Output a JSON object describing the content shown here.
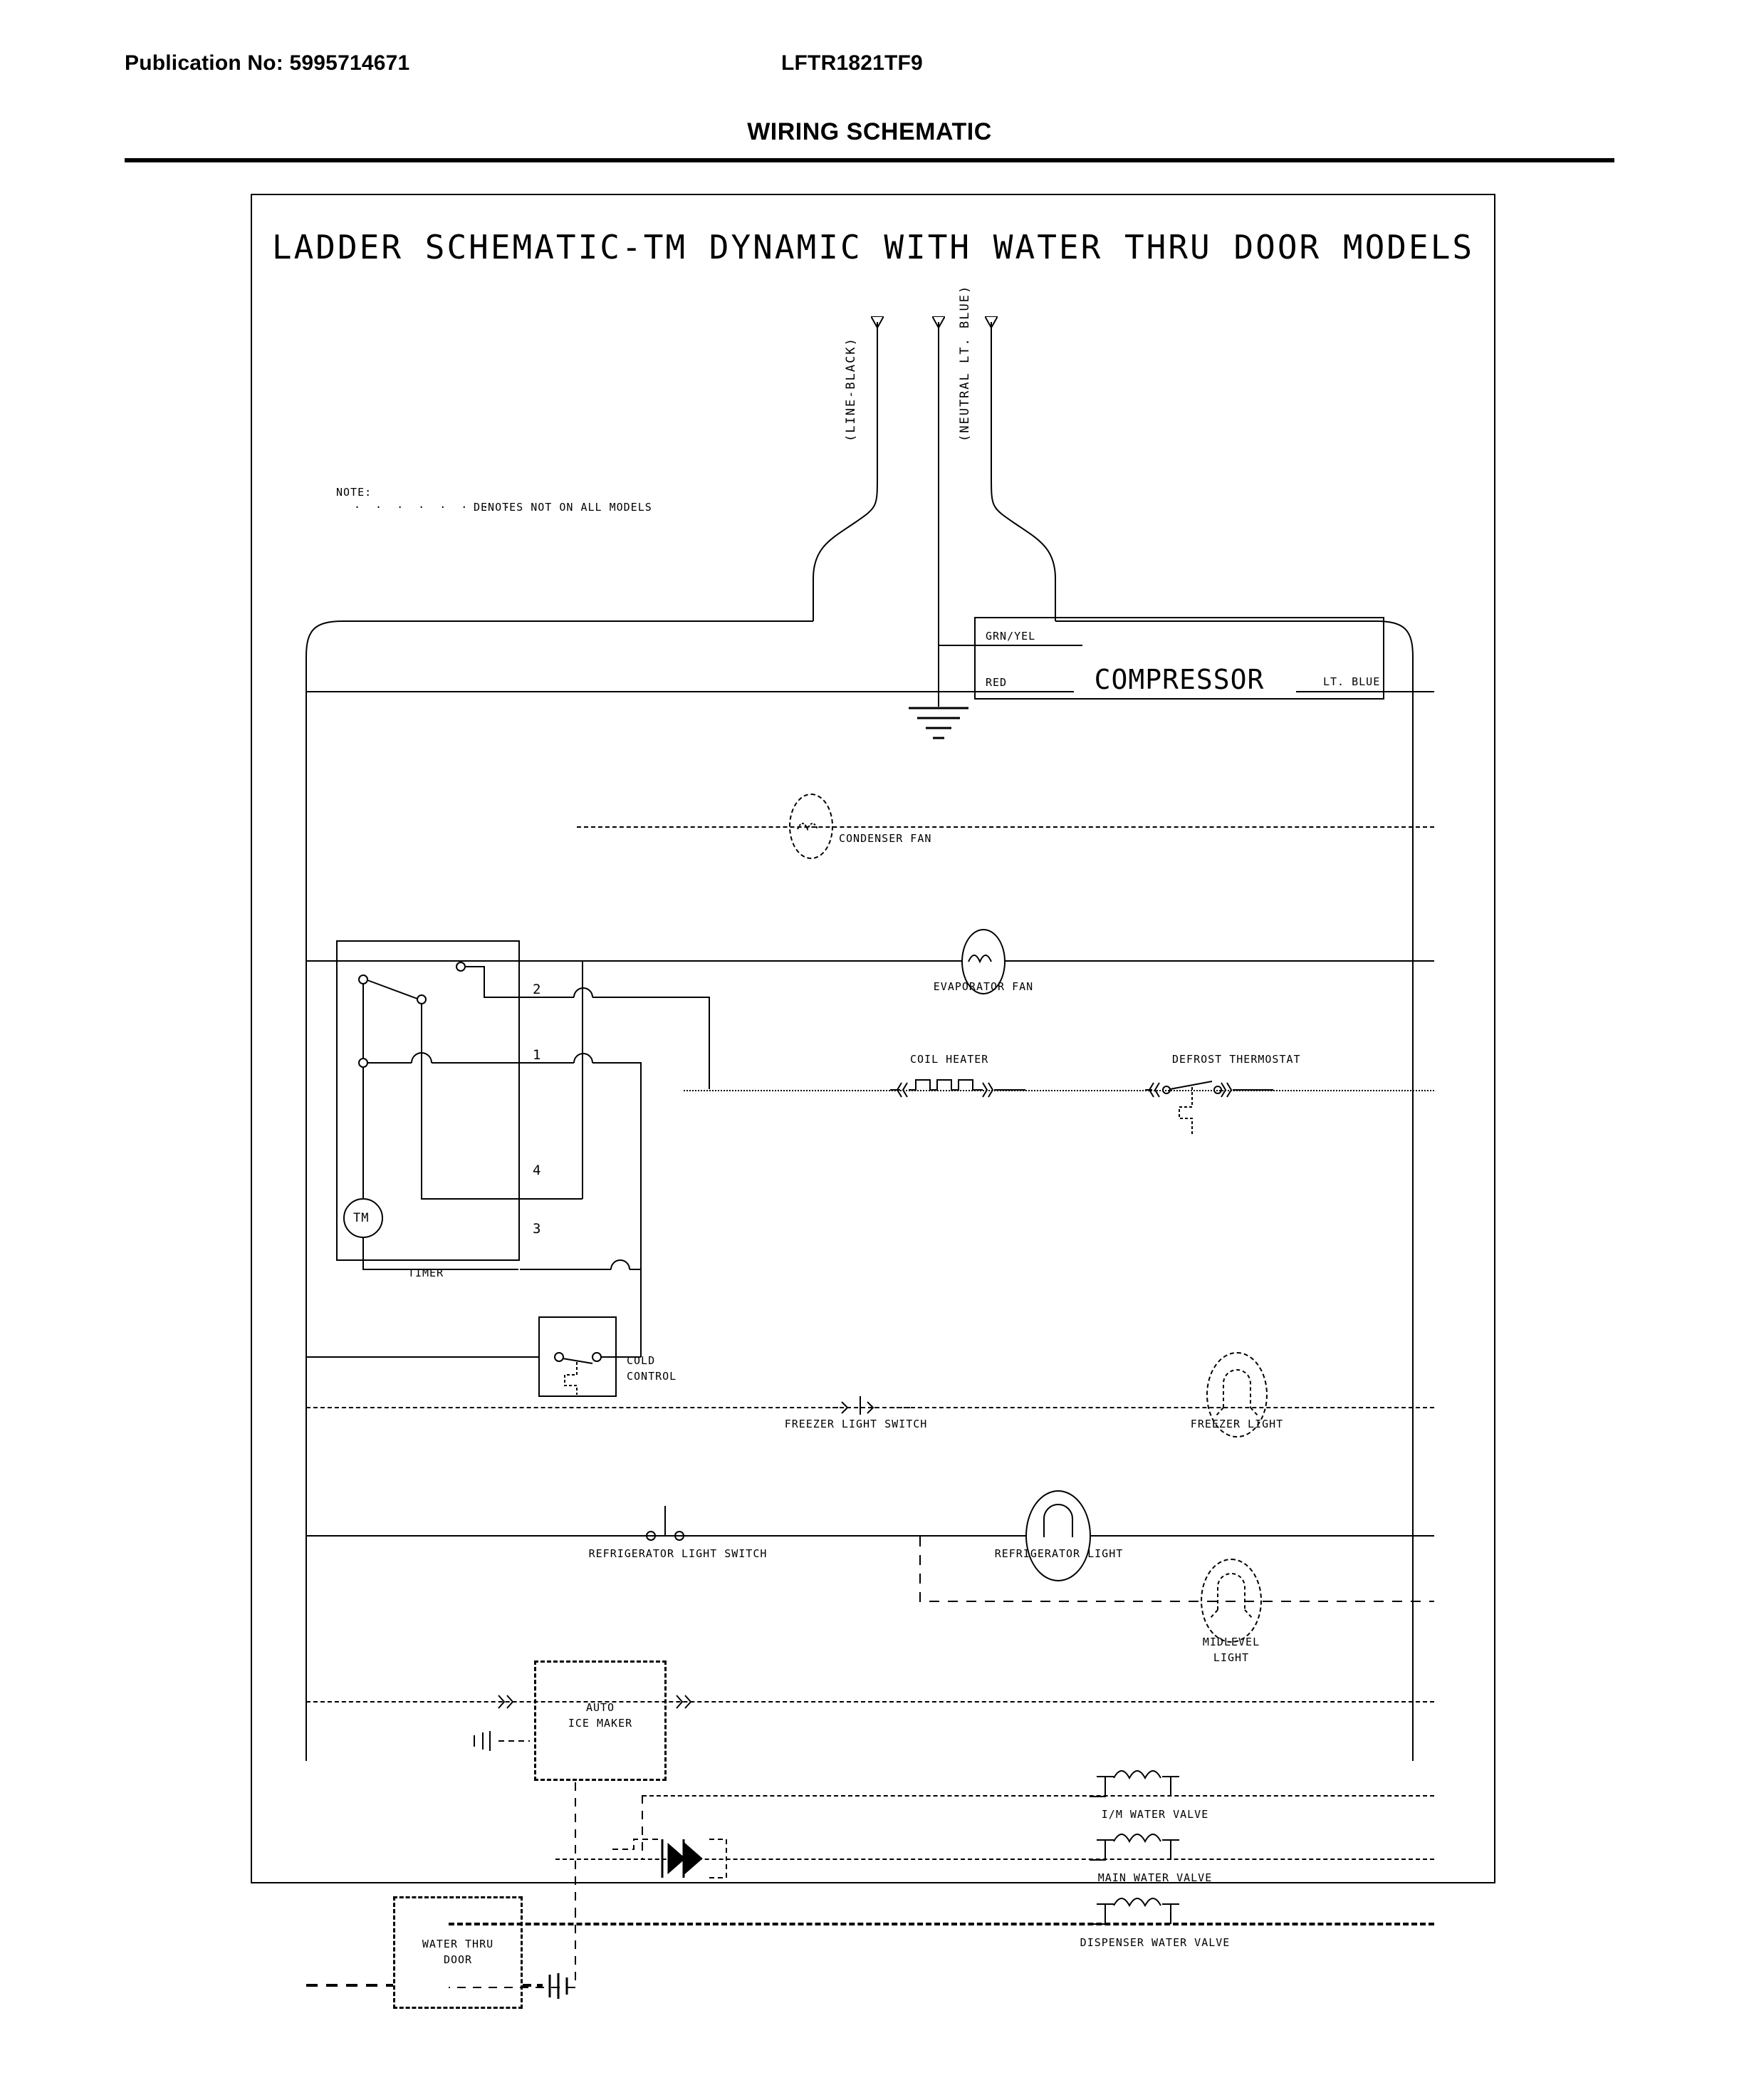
{
  "header": {
    "publication_label": "Publication No: 5995714671",
    "model": "LFTR1821TF9",
    "title": "WIRING SCHEMATIC"
  },
  "schematic": {
    "title": "LADDER SCHEMATIC-TM DYNAMIC WITH WATER THRU DOOR MODELS",
    "note_heading": "NOTE:",
    "note_text": "DENOTES NOT ON ALL MODELS",
    "note_dashes": "· · · · · · · ·",
    "supply": {
      "line": "(LINE-BLACK)",
      "neutral": "(NEUTRAL LT. BLUE)"
    },
    "compressor": {
      "name": "COMPRESSOR",
      "terminal_ground": "GRN/YEL",
      "terminal_left": "RED",
      "terminal_right": "LT. BLUE"
    },
    "components": [
      {
        "id": "condenser-fan",
        "label": "CONDENSER FAN"
      },
      {
        "id": "evaporator-fan",
        "label": "EVAPORATOR FAN"
      },
      {
        "id": "coil-heater",
        "label": "COIL HEATER"
      },
      {
        "id": "defrost-thermostat",
        "label": "DEFROST THERMOSTAT"
      },
      {
        "id": "timer",
        "label": "TIMER"
      },
      {
        "id": "timer-motor",
        "label": "TM"
      },
      {
        "id": "cold-control",
        "label": "COLD\nCONTROL"
      },
      {
        "id": "freezer-light-switch",
        "label": "FREEZER LIGHT SWITCH"
      },
      {
        "id": "freezer-light",
        "label": "FREEZER LIGHT"
      },
      {
        "id": "refrigerator-light-switch",
        "label": "REFRIGERATOR LIGHT SWITCH"
      },
      {
        "id": "refrigerator-light",
        "label": "REFRIGERATOR LIGHT"
      },
      {
        "id": "midlevel-light",
        "label": "MIDLEVEL\nLIGHT"
      },
      {
        "id": "auto-ice-maker",
        "label": "AUTO\nICE MAKER"
      },
      {
        "id": "im-water-valve",
        "label": "I/M WATER VALVE"
      },
      {
        "id": "main-water-valve",
        "label": "MAIN WATER VALVE"
      },
      {
        "id": "dispenser-water-valve",
        "label": "DISPENSER WATER VALVE"
      },
      {
        "id": "water-thru-door",
        "label": "WATER THRU\nDOOR"
      }
    ],
    "labels": {
      "condenser_fan": "CONDENSER FAN",
      "evaporator_fan": "EVAPORATOR FAN",
      "coil_heater": "COIL HEATER",
      "defrost_thermostat": "DEFROST THERMOSTAT",
      "timer": "TIMER",
      "timer_motor": "TM",
      "cold_control_l1": "COLD",
      "cold_control_l2": "CONTROL",
      "freezer_light_switch": "FREEZER LIGHT SWITCH",
      "freezer_light": "FREEZER LIGHT",
      "refrigerator_light_switch": "REFRIGERATOR LIGHT SWITCH",
      "refrigerator_light": "REFRIGERATOR LIGHT",
      "midlevel_light_l1": "MIDLEVEL",
      "midlevel_light_l2": "LIGHT",
      "auto_ice_maker_l1": "AUTO",
      "auto_ice_maker_l2": "ICE MAKER",
      "im_water_valve": "I/M WATER VALVE",
      "main_water_valve": "MAIN WATER VALVE",
      "dispenser_water_valve": "DISPENSER WATER VALVE",
      "water_thru_door_l1": "WATER THRU",
      "water_thru_door_l2": "DOOR"
    },
    "timer_terminals": [
      "1",
      "2",
      "3",
      "4"
    ]
  },
  "colors": {
    "ink": "#000000",
    "paper": "#ffffff"
  }
}
